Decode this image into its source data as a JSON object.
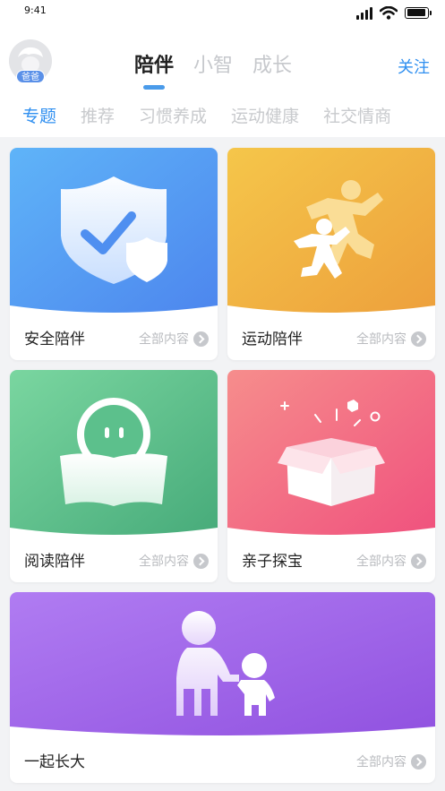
{
  "status_bar": {
    "time": "9:41",
    "battery_level": 0.95
  },
  "header": {
    "avatar_badge": "爸爸",
    "main_tabs": [
      {
        "label": "陪伴",
        "active": true
      },
      {
        "label": "小智",
        "active": false
      },
      {
        "label": "成长",
        "active": false
      }
    ],
    "follow_label": "关注",
    "sub_tabs": [
      {
        "label": "专题",
        "active": true
      },
      {
        "label": "推荐",
        "active": false
      },
      {
        "label": "习惯养成",
        "active": false
      },
      {
        "label": "运动健康",
        "active": false
      },
      {
        "label": "社交情商",
        "active": false
      }
    ]
  },
  "cards": [
    {
      "title": "安全陪伴",
      "more": "全部内容",
      "icon": "shield-check-icon",
      "colors": [
        "#5fb4f8",
        "#4d86ee"
      ]
    },
    {
      "title": "运动陪伴",
      "more": "全部内容",
      "icon": "running-people-icon",
      "colors": [
        "#f5c64a",
        "#eda03c"
      ]
    },
    {
      "title": "阅读陪伴",
      "more": "全部内容",
      "icon": "reading-robot-icon",
      "colors": [
        "#7ad6a0",
        "#47ab7a"
      ]
    },
    {
      "title": "亲子探宝",
      "more": "全部内容",
      "icon": "gift-box-icon",
      "colors": [
        "#f68d8c",
        "#f0527e"
      ]
    },
    {
      "title": "一起长大",
      "more": "全部内容",
      "icon": "parent-child-icon",
      "colors": [
        "#b07cf2",
        "#9152e0"
      ]
    }
  ]
}
